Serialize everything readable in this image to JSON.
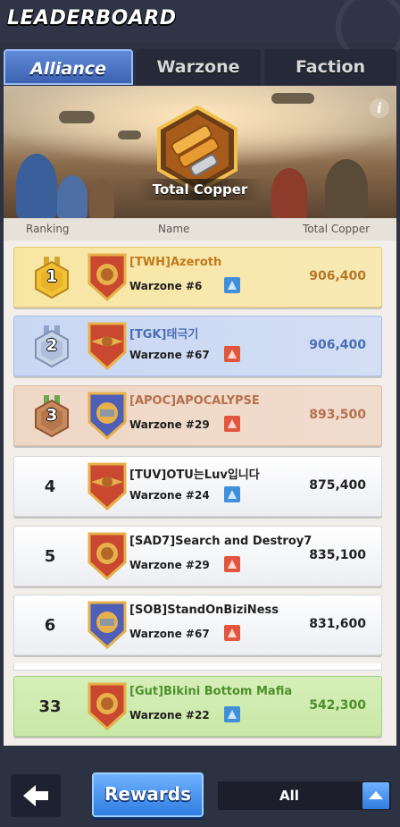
{
  "header": {
    "title": "LEADERBOARD"
  },
  "tabs": [
    {
      "label": "Alliance",
      "active": true
    },
    {
      "label": "Warzone",
      "active": false
    },
    {
      "label": "Faction",
      "active": false
    }
  ],
  "banner": {
    "caption": "Total Copper",
    "info_icon": "info-icon"
  },
  "columns": {
    "ranking": "Ranking",
    "name": "Name",
    "total": "Total Copper"
  },
  "rows": [
    {
      "rank": "1",
      "name": "[TWH]Azeroth",
      "warzone": "Warzone #6",
      "copper": "906,400",
      "medal": "gold",
      "emblem": "red",
      "zone_icon": "blue"
    },
    {
      "rank": "2",
      "name": "[TGK]태극기",
      "warzone": "Warzone #67",
      "copper": "906,400",
      "medal": "silver",
      "emblem": "red",
      "zone_icon": "red"
    },
    {
      "rank": "3",
      "name": "[APOC]APOCALYPSE",
      "warzone": "Warzone #29",
      "copper": "893,500",
      "medal": "bronze",
      "emblem": "blue",
      "zone_icon": "red"
    },
    {
      "rank": "4",
      "name": "[TUV]OTU는Luv입니다",
      "warzone": "Warzone #24",
      "copper": "875,400",
      "emblem": "red",
      "zone_icon": "blue"
    },
    {
      "rank": "5",
      "name": "[SAD7]Search and Destroy7",
      "warzone": "Warzone #29",
      "copper": "835,100",
      "emblem": "red",
      "zone_icon": "red"
    },
    {
      "rank": "6",
      "name": "[SOB]StandOnBiziNess",
      "warzone": "Warzone #67",
      "copper": "831,600",
      "emblem": "blue",
      "zone_icon": "red"
    }
  ],
  "my_row": {
    "rank": "33",
    "name": "[Gut]Bikini Bottom Mafia",
    "warzone": "Warzone #22",
    "copper": "542,300",
    "emblem": "red",
    "zone_icon": "blue"
  },
  "bottom": {
    "rewards_label": "Rewards",
    "filter_value": "All"
  },
  "colors": {
    "accent": "#3c7fe0",
    "gold": "#c07a1d",
    "silver_blue": "#4a6fb5",
    "bronze": "#b5704e",
    "green": "#4e8f2c"
  }
}
